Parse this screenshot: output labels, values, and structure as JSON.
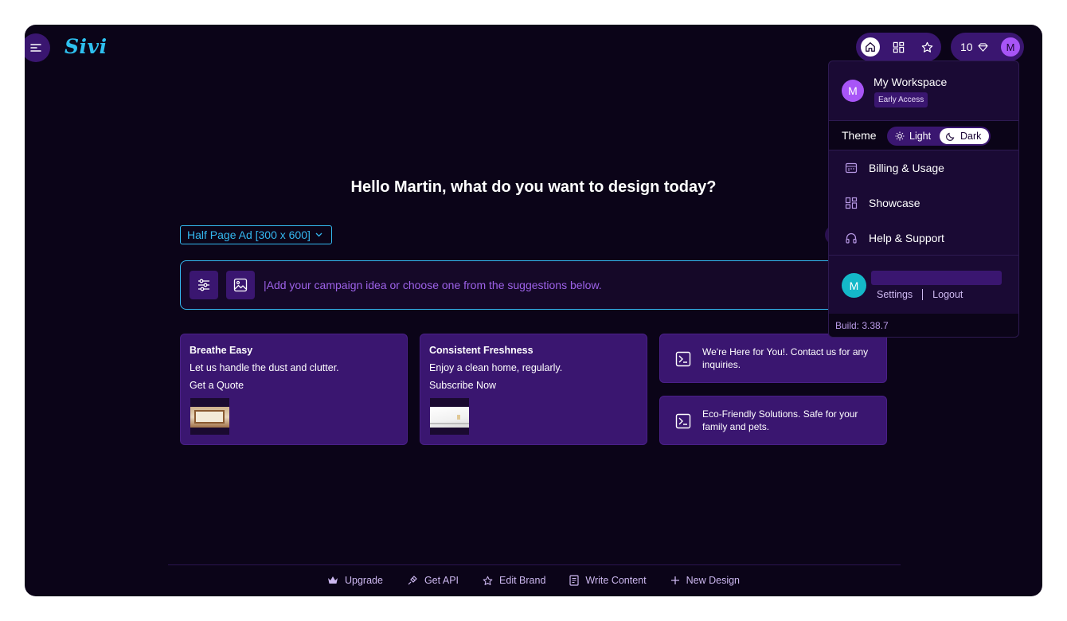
{
  "app": {
    "logo": "Sivi"
  },
  "header": {
    "nav": [
      {
        "icon": "home-icon",
        "active": true
      },
      {
        "icon": "grid-icon",
        "active": false
      },
      {
        "icon": "star-icon",
        "active": false
      }
    ],
    "credits": "10",
    "avatar_letter": "M"
  },
  "main": {
    "greeting": "Hello Martin, what do you want to design today?",
    "size_select": "Half Page Ad [300 x 600]",
    "prompt_placeholder": "|Add your campaign idea or choose one from the suggestions below."
  },
  "cards": [
    {
      "title": "Breathe Easy",
      "desc": "Let us handle the dust and clutter.",
      "cta": "Get a Quote"
    },
    {
      "title": "Consistent Freshness",
      "desc": "Enjoy a clean home, regularly.",
      "cta": "Subscribe Now"
    }
  ],
  "suggestions": [
    {
      "text": "We're Here for You!. Contact us for any inquiries."
    },
    {
      "text": "Eco-Friendly Solutions. Safe for your family and pets."
    }
  ],
  "footer": [
    {
      "label": "Upgrade",
      "icon": "crown-icon"
    },
    {
      "label": "Get API",
      "icon": "plug-icon"
    },
    {
      "label": "Edit Brand",
      "icon": "star-icon"
    },
    {
      "label": "Write Content",
      "icon": "document-icon"
    },
    {
      "label": "New Design",
      "icon": "plus-icon"
    }
  ],
  "dropdown": {
    "avatar_letter": "M",
    "workspace": "My Workspace",
    "badge": "Early Access",
    "theme_label": "Theme",
    "theme_light": "Light",
    "theme_dark": "Dark",
    "theme_selected": "Dark",
    "items": [
      {
        "label": "Billing & Usage",
        "icon": "billing-icon"
      },
      {
        "label": "Showcase",
        "icon": "showcase-icon"
      },
      {
        "label": "Help & Support",
        "icon": "headset-icon"
      }
    ],
    "user_avatar_letter": "M",
    "settings": "Settings",
    "logout": "Logout",
    "build": "Build: 3.38.7"
  },
  "colors": {
    "background": "#0b0418",
    "surface": "#3a1670",
    "accent": "#34b8f0",
    "placeholder": "#9d62e8",
    "avatar": "#a855f7",
    "user_avatar": "#14b8c8"
  }
}
